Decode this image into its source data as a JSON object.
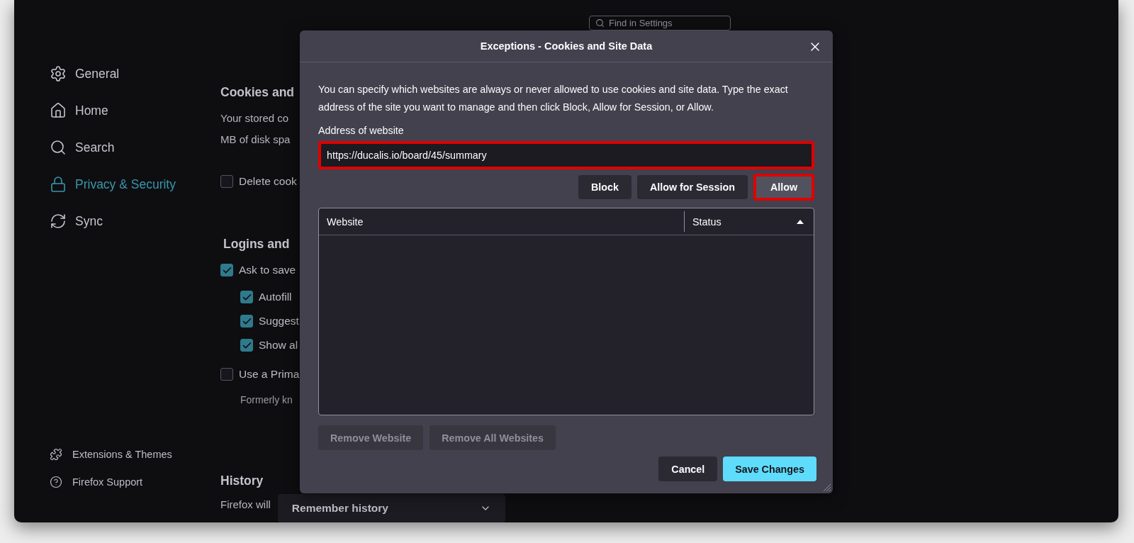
{
  "sidebar": {
    "items": [
      {
        "label": "General",
        "selected": false
      },
      {
        "label": "Home",
        "selected": false
      },
      {
        "label": "Search",
        "selected": false
      },
      {
        "label": "Privacy & Security",
        "selected": true
      },
      {
        "label": "Sync",
        "selected": false
      }
    ],
    "footer_links": [
      {
        "label": "Extensions & Themes"
      },
      {
        "label": "Firefox Support"
      }
    ]
  },
  "search": {
    "placeholder": "Find in Settings"
  },
  "content": {
    "sections": [
      {
        "heading": "Cookies and",
        "rows": [
          {
            "kind": "text",
            "text": "Your stored co"
          },
          {
            "kind": "text",
            "text": "MB of disk spa"
          },
          {
            "kind": "checkbox",
            "label": "Delete cook",
            "checked": false
          }
        ]
      },
      {
        "heading": "Logins and",
        "rows": [
          {
            "kind": "checkbox",
            "label": "Ask to save",
            "checked": true,
            "children": [
              {
                "label": "Autofill",
                "checked": true
              },
              {
                "label": "Suggest",
                "checked": true
              },
              {
                "label": "Show al",
                "checked": true
              }
            ]
          },
          {
            "kind": "checkbox",
            "label": "Use a Prima",
            "checked": false
          },
          {
            "kind": "note",
            "text": "Formerly kn"
          }
        ]
      }
    ],
    "history": {
      "heading": "History",
      "label": "Firefox will",
      "dropdown": "Remember history"
    }
  },
  "dialog": {
    "title": "Exceptions - Cookies and Site Data",
    "description": "You can specify which websites are always or never allowed to use cookies and site data. Type the exact address of the site you want to manage and then click Block, Allow for Session, or Allow.",
    "address_label": "Address of website",
    "address_value": "https://ducalis.io/board/45/summary",
    "address_highlighted": true,
    "actions": [
      {
        "label": "Block",
        "highlighted": false
      },
      {
        "label": "Allow for Session",
        "highlighted": false
      },
      {
        "label": "Allow",
        "highlighted": true
      }
    ],
    "table": {
      "columns": [
        {
          "label": "Website"
        },
        {
          "label": "Status",
          "sorted_ascending": true
        }
      ]
    },
    "remove_buttons": [
      {
        "label": "Remove Website",
        "disabled": true
      },
      {
        "label": "Remove All Websites",
        "disabled": true
      }
    ],
    "footer_buttons": [
      {
        "label": "Cancel",
        "kind": "secondary"
      },
      {
        "label": "Save Changes",
        "kind": "primary"
      }
    ]
  }
}
